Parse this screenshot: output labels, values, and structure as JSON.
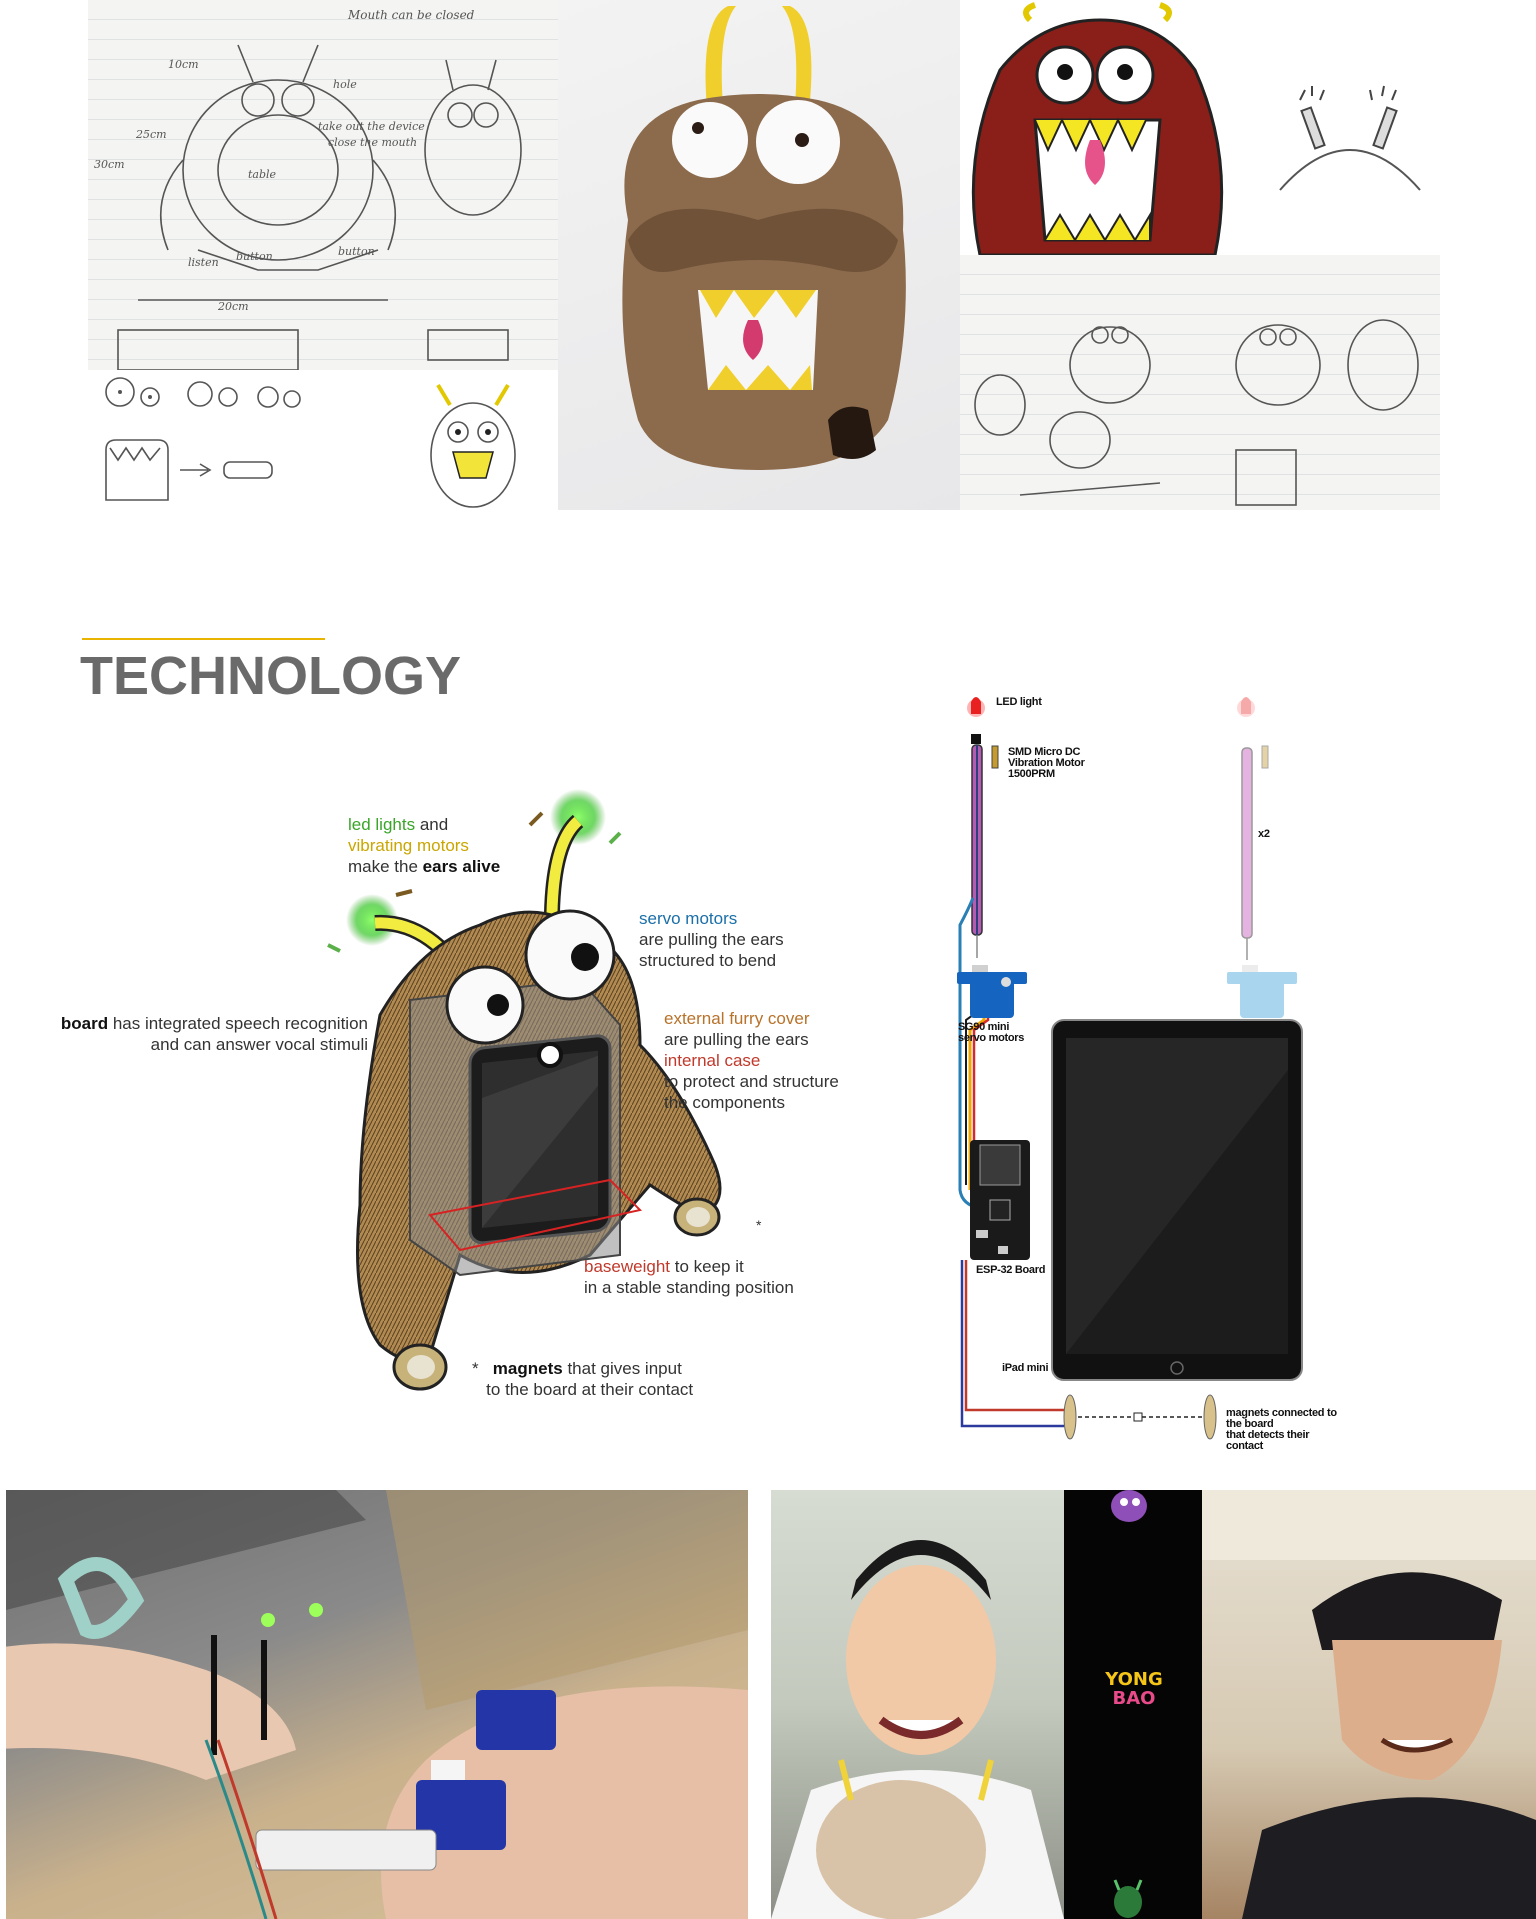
{
  "section": {
    "title": "TECHNOLOGY"
  },
  "sketches": {
    "notes": [
      "Mouth can be closed",
      "hole",
      "take out the device",
      "close the mouth",
      "table",
      "listen",
      "button",
      "button",
      "20cm",
      "25cm",
      "10cm",
      "30cm"
    ]
  },
  "annotations": {
    "ears": {
      "led": "led lights",
      "and": " and",
      "vibrating": "vibrating motors",
      "line3a": "make the ",
      "line3b": "ears alive"
    },
    "servo": {
      "title": "servo motors",
      "line2": "are pulling the ears",
      "line3": "structured to bend"
    },
    "board": {
      "title": "board",
      "rest": " has integrated speech recognition",
      "line2": "and can answer vocal stimuli"
    },
    "cover": {
      "title": "external furry cover",
      "line2": "are pulling the ears",
      "case": "internal case",
      "line4": "to protect and structure",
      "line5": "the components"
    },
    "base": {
      "title": "baseweight",
      "rest": " to keep it",
      "line2": "in a stable standing position"
    },
    "magnets": {
      "star": "*",
      "title": "magnets",
      "rest": " that gives input",
      "line2": "to the board at their contact"
    },
    "asterisk": "*"
  },
  "diagram": {
    "led": "LED light",
    "vibration1": "SMD Micro DC",
    "vibration2": "Vibration Motor",
    "vibration3": "1500PRM",
    "x2": "x2",
    "servo1": "SG90 mini",
    "servo2": "servo motors",
    "esp": "ESP-32 Board",
    "ipad": "iPad mini",
    "magnets1": "magnets connected to the board",
    "magnets2": "that detects their contact"
  },
  "photo_app": {
    "logo1": "YONG",
    "logo2": "BAO"
  },
  "colors": {
    "title": "#6a6a6a",
    "rule": "#e8b400",
    "led_green": "#3aa529",
    "motor_yellow": "#c9a600",
    "servo_blue": "#1b6fa8",
    "cover_brown": "#b8722a",
    "base_red": "#c0392b"
  }
}
